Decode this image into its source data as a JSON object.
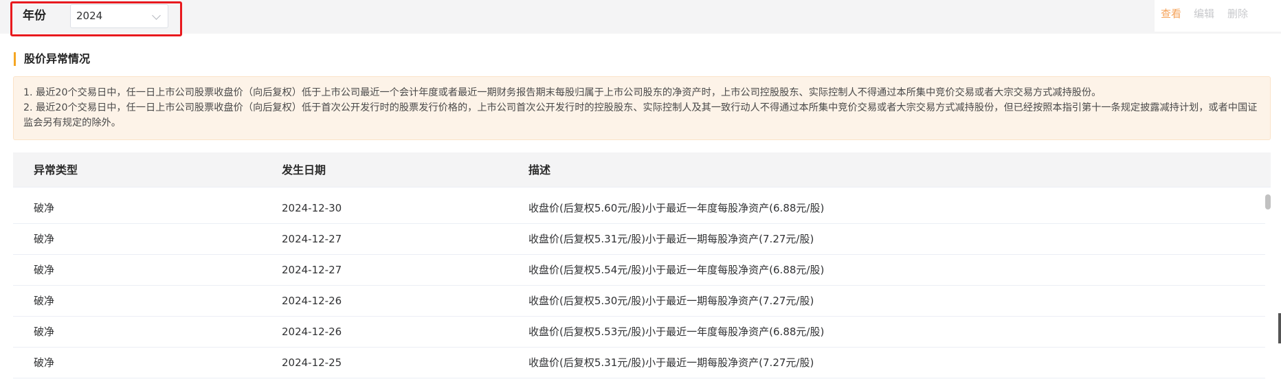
{
  "filter": {
    "year_label": "年份",
    "year_value": "2024"
  },
  "actions": {
    "view": "查看",
    "edit": "编辑",
    "delete": "删除"
  },
  "section": {
    "title": "股价异常情况"
  },
  "notice": {
    "line1": "1. 最近20个交易日中，任一日上市公司股票收盘价（向后复权）低于上市公司最近一个会计年度或者最近一期财务报告期末每股归属于上市公司股东的净资产时，上市公司控股股东、实际控制人不得通过本所集中竞价交易或者大宗交易方式减持股份。",
    "line2": "2. 最近20个交易日中，任一日上市公司股票收盘价（向后复权）低于首次公开发行时的股票发行价格的，上市公司首次公开发行时的控股股东、实际控制人及其一致行动人不得通过本所集中竞价交易或者大宗交易方式减持股份，但已经按照本指引第十一条规定披露减持计划，或者中国证监会另有规定的除外。"
  },
  "table": {
    "headers": [
      "异常类型",
      "发生日期",
      "描述"
    ],
    "rows": [
      [
        "破净",
        "2024-12-30",
        "收盘价(后复权5.60元/股)小于最近一年度每股净资产(6.88元/股)"
      ],
      [
        "破净",
        "2024-12-27",
        "收盘价(后复权5.31元/股)小于最近一期每股净资产(7.27元/股)"
      ],
      [
        "破净",
        "2024-12-27",
        "收盘价(后复权5.54元/股)小于最近一年度每股净资产(6.88元/股)"
      ],
      [
        "破净",
        "2024-12-26",
        "收盘价(后复权5.30元/股)小于最近一期每股净资产(7.27元/股)"
      ],
      [
        "破净",
        "2024-12-26",
        "收盘价(后复权5.53元/股)小于最近一年度每股净资产(6.88元/股)"
      ],
      [
        "破净",
        "2024-12-25",
        "收盘价(后复权5.31元/股)小于最近一期每股净资产(7.27元/股)"
      ]
    ]
  },
  "colors": {
    "accent_orange": "#f5a623",
    "view_action": "#f5a35a",
    "disabled_action": "#c8c9cc",
    "highlight_border": "#e8191e",
    "notice_bg": "#fdf3e8"
  },
  "icons": {
    "select_caret": "chevron-down-icon"
  }
}
